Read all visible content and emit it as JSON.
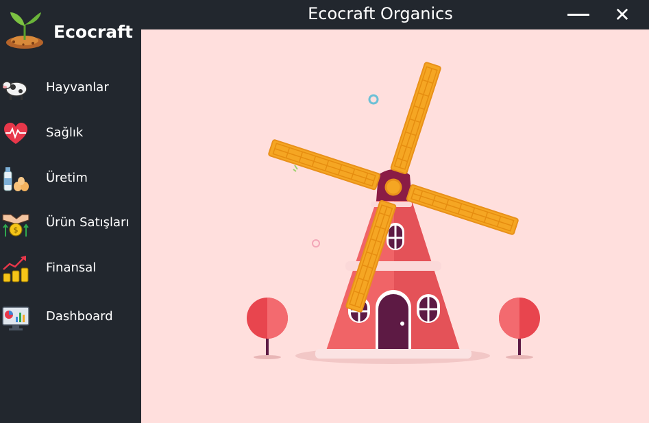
{
  "window": {
    "title": "Ecocraft Organics",
    "minimize_icon": "minimize-icon",
    "close_icon": "close-icon",
    "close_glyph": "✕"
  },
  "sidebar": {
    "brand": {
      "name": "Ecocraft",
      "logo_icon": "sprout-logo-icon"
    },
    "items": [
      {
        "label": "Hayvanlar",
        "icon": "cow-icon"
      },
      {
        "label": "Sağlık",
        "icon": "heartbeat-icon"
      },
      {
        "label": "Üretim",
        "icon": "milk-eggs-icon"
      },
      {
        "label": "Ürün Satışları",
        "icon": "handshake-money-icon"
      },
      {
        "label": "Finansal",
        "icon": "coins-growth-icon"
      },
      {
        "label": "Dashboard",
        "icon": "dashboard-monitor-icon"
      }
    ]
  },
  "main": {
    "illustration": "windmill-illustration"
  },
  "colors": {
    "sidebar_bg": "#22272e",
    "content_bg": "#ffdfdd",
    "windmill_body": "#f06467",
    "blade": "#f5a623",
    "door": "#5d1a44"
  }
}
